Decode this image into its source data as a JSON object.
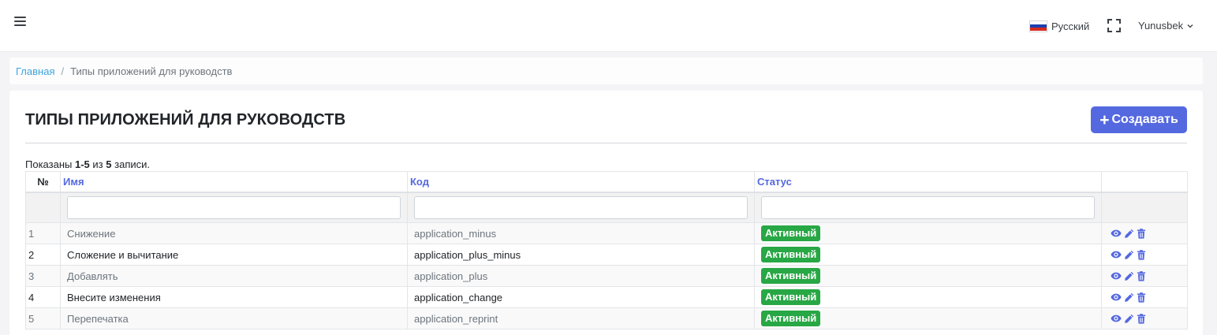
{
  "colors": {
    "accent": "#5468e0",
    "link": "#3ea3dc",
    "status_active": "#28a745"
  },
  "header": {
    "menu_icon": "hamburger-icon",
    "language": {
      "label": "Русский",
      "flag_icon": "russia-flag-icon"
    },
    "fullscreen_icon": "fullscreen-icon",
    "user": {
      "name": "Yunusbek",
      "chevron_icon": "chevron-down-icon"
    }
  },
  "breadcrumb": {
    "home": "Главная",
    "separator": "/",
    "current": "Типы приложений для руководств"
  },
  "page": {
    "title": "ТИПЫ ПРИЛОЖЕНИЙ ДЛЯ РУКОВОДСТВ",
    "create_button": {
      "icon": "plus",
      "label": "Создавать"
    }
  },
  "summary": {
    "prefix": "Показаны",
    "range": "1-5",
    "middle": "из",
    "total": "5",
    "suffix": "записи."
  },
  "table": {
    "columns": {
      "num": "№",
      "name": "Имя",
      "code": "Код",
      "status": "Статус"
    },
    "filters": {
      "name": "",
      "code": "",
      "status": ""
    },
    "rows": [
      {
        "num": "1",
        "name": "Снижение",
        "code": "application_minus",
        "status": "Активный"
      },
      {
        "num": "2",
        "name": "Сложение и вычитание",
        "code": "application_plus_minus",
        "status": "Активный"
      },
      {
        "num": "3",
        "name": "Добавлять",
        "code": "application_plus",
        "status": "Активный"
      },
      {
        "num": "4",
        "name": "Внесите изменения",
        "code": "application_change",
        "status": "Активный"
      },
      {
        "num": "5",
        "name": "Перепечатка",
        "code": "application_reprint",
        "status": "Активный"
      }
    ],
    "row_actions": [
      "eye-icon",
      "pencil-icon",
      "trash-icon"
    ]
  }
}
